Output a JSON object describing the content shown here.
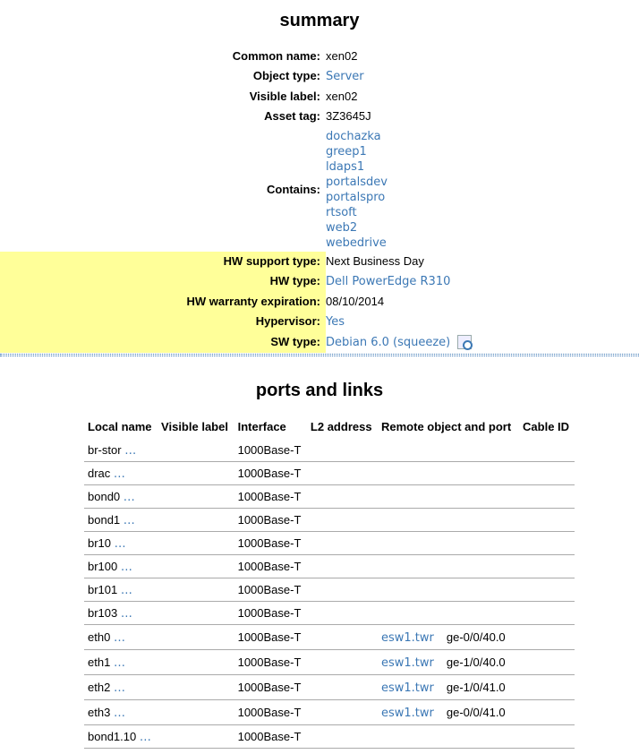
{
  "summary": {
    "title": "summary",
    "common_name": {
      "label": "Common name:",
      "value": "xen02"
    },
    "object_type": {
      "label": "Object type:",
      "value": "Server"
    },
    "visible_label": {
      "label": "Visible label:",
      "value": "xen02"
    },
    "asset_tag": {
      "label": "Asset tag:",
      "value": "3Z3645J"
    },
    "contains": {
      "label": "Contains:",
      "items": [
        "dochazka",
        "greep1",
        "ldaps1",
        "portalsdev",
        "portalspro",
        "rtsoft",
        "web2",
        "webedrive"
      ]
    },
    "hw_support_type": {
      "label": "HW support type:",
      "value": "Next Business Day"
    },
    "hw_type": {
      "label": "HW type:",
      "value": "Dell PowerEdge R310"
    },
    "hw_warranty": {
      "label": "HW warranty expiration:",
      "value": "08/10/2014"
    },
    "hypervisor": {
      "label": "Hypervisor:",
      "value": "Yes"
    },
    "sw_type": {
      "label": "SW type:",
      "value": "Debian 6.0 (squeeze)",
      "icon": "search-doc-icon"
    },
    "highlight_color": "#ffff99",
    "link_color": "#3c78b5"
  },
  "ports": {
    "title": "ports and links",
    "headers": [
      "Local name",
      "Visible label",
      "Interface",
      "L2 address",
      "Remote object and port",
      "Cable ID"
    ],
    "more_marker": "…",
    "rows": [
      {
        "name": "br-stor",
        "iface": "1000Base-T",
        "remote": "",
        "remote_port": ""
      },
      {
        "name": "drac",
        "iface": "1000Base-T",
        "remote": "",
        "remote_port": ""
      },
      {
        "name": "bond0",
        "iface": "1000Base-T",
        "remote": "",
        "remote_port": ""
      },
      {
        "name": "bond1",
        "iface": "1000Base-T",
        "remote": "",
        "remote_port": ""
      },
      {
        "name": "br10",
        "iface": "1000Base-T",
        "remote": "",
        "remote_port": ""
      },
      {
        "name": "br100",
        "iface": "1000Base-T",
        "remote": "",
        "remote_port": ""
      },
      {
        "name": "br101",
        "iface": "1000Base-T",
        "remote": "",
        "remote_port": ""
      },
      {
        "name": "br103",
        "iface": "1000Base-T",
        "remote": "",
        "remote_port": ""
      },
      {
        "name": "eth0",
        "iface": "1000Base-T",
        "remote": "esw1.twr",
        "remote_port": "ge-0/0/40.0"
      },
      {
        "name": "eth1",
        "iface": "1000Base-T",
        "remote": "esw1.twr",
        "remote_port": "ge-1/0/40.0"
      },
      {
        "name": "eth2",
        "iface": "1000Base-T",
        "remote": "esw1.twr",
        "remote_port": "ge-1/0/41.0"
      },
      {
        "name": "eth3",
        "iface": "1000Base-T",
        "remote": "esw1.twr",
        "remote_port": "ge-0/0/41.0"
      },
      {
        "name": "bond1.10",
        "iface": "1000Base-T",
        "remote": "",
        "remote_port": ""
      }
    ]
  }
}
